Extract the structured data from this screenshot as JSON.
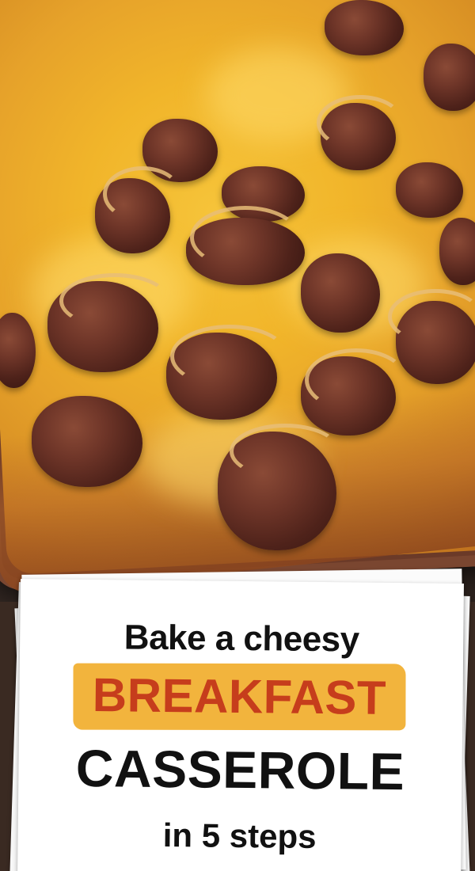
{
  "image": {
    "subject": "cheesy sausage breakfast casserole",
    "accent_colors": {
      "cheese": "#f1b52a",
      "meat": "#5a281d",
      "highlight": "#f2b43d",
      "highlight_text": "#c63d1c"
    }
  },
  "headline": {
    "line1": "Bake a cheesy",
    "line2_highlight": "BREAKFAST",
    "line3": "CASSEROLE",
    "line4": "in 5 steps"
  }
}
